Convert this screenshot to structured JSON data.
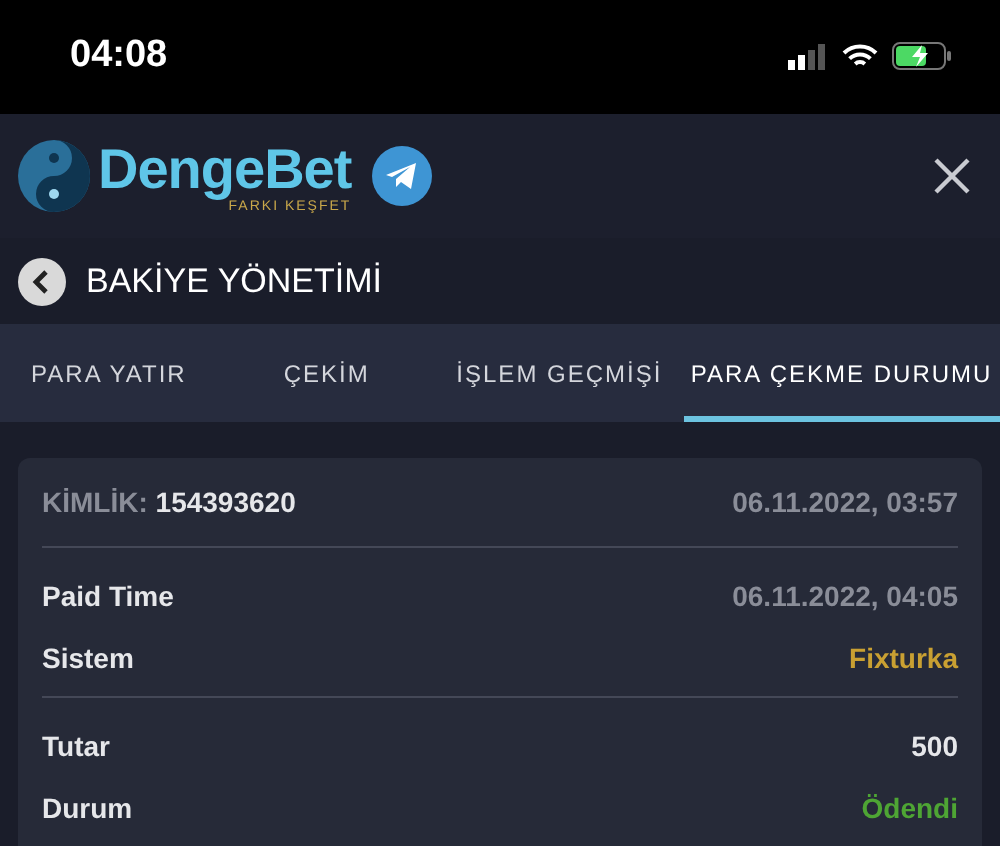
{
  "status_bar": {
    "time": "04:08"
  },
  "header": {
    "logo_text": "DengeBet",
    "logo_tagline": "FARKI KEŞFET"
  },
  "page_title": "BAKİYE YÖNETİMİ",
  "tabs": [
    {
      "label": "PARA YATIR",
      "selected": false
    },
    {
      "label": "ÇEKİM",
      "selected": false
    },
    {
      "label": "İŞLEM GEÇMİŞİ",
      "selected": false
    },
    {
      "label": "PARA ÇEKME DURUMU",
      "selected": true
    }
  ],
  "card": {
    "id_label": "KİMLİK:",
    "id_value": "154393620",
    "created": "06.11.2022, 03:57",
    "groups": [
      [
        {
          "label": "Paid Time",
          "value": "06.11.2022, 04:05",
          "color": "#8a8d98"
        },
        {
          "label": "Sistem",
          "value": "Fixturka",
          "color": "#c9a032"
        }
      ],
      [
        {
          "label": "Tutar",
          "value": "500",
          "color": "#e6e7ea"
        },
        {
          "label": "Durum",
          "value": "Ödendi",
          "color": "#4ea534"
        }
      ]
    ]
  }
}
